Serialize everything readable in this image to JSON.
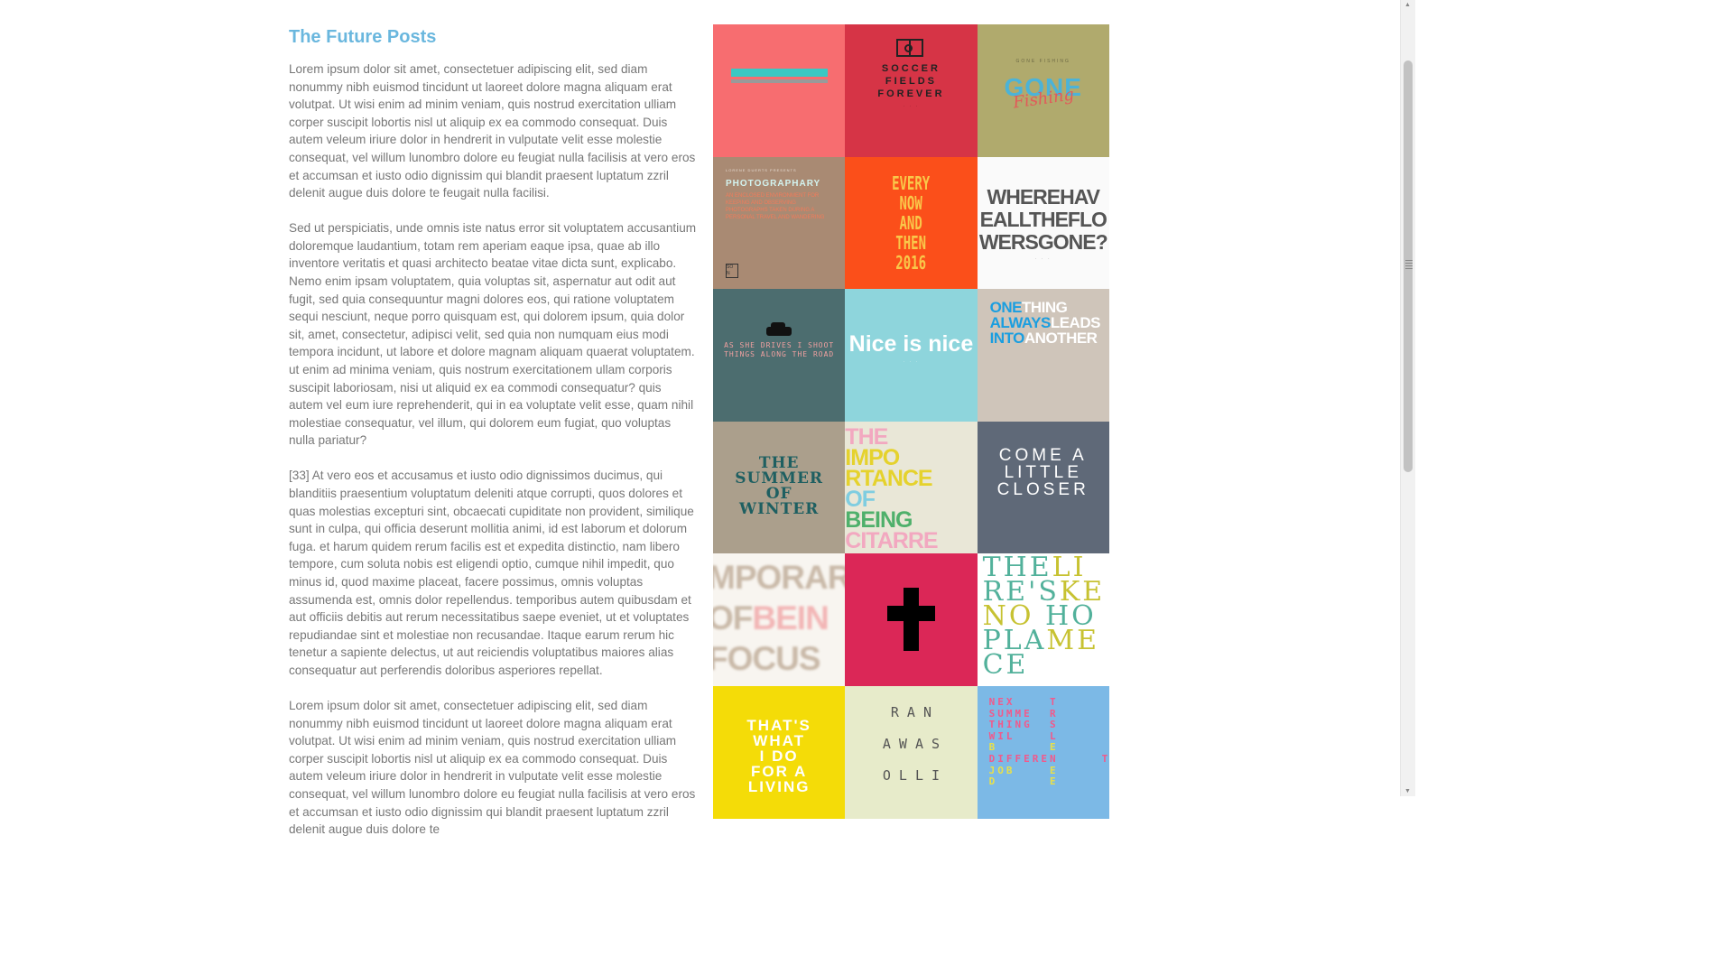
{
  "article": {
    "title": "The Future Posts",
    "paragraphs": [
      "Lorem ipsum dolor sit amet, consectetuer adipiscing elit, sed diam nonummy nibh euismod tincidunt ut laoreet dolore magna aliquam erat volutpat. Ut wisi enim ad minim veniam, quis nostrud exercitation ulliam corper suscipit lobortis nisl ut aliquip ex ea commodo consequat. Duis autem veleum iriure dolor in hendrerit in vulputate velit esse molestie consequat, vel willum lunombro dolore eu feugiat nulla facilisis at vero eros et accumsan et iusto odio dignissim qui blandit praesent luptatum zzril delenit augue duis dolore te feugait nulla facilisi.",
      "Sed ut perspiciatis, unde omnis iste natus error sit voluptatem accusantium doloremque laudantium, totam rem aperiam eaque ipsa, quae ab illo inventore veritatis et quasi architecto beatae vitae dicta sunt, explicabo. Nemo enim ipsam voluptatem, quia voluptas sit, aspernatur aut odit aut fugit, sed quia consequuntur magni dolores eos, qui ratione voluptatem sequi nesciunt, neque porro quisquam est, qui dolorem ipsum, quia dolor sit, amet, consectetur, adipisci velit, sed quia non numquam eius modi tempora incidunt, ut labore et dolore magnam aliquam quaerat voluptatem. ut enim ad minima veniam, quis nostrum exercitationem ullam corporis suscipit laboriosam, nisi ut aliquid ex ea commodi consequatur? quis autem vel eum iure reprehenderit, qui in ea voluptate velit esse, quam nihil molestiae consequatur, vel illum, qui dolorem eum fugiat, quo voluptas nulla pariatur?",
      "[33] At vero eos et accusamus et iusto odio dignissimos ducimus, qui blanditiis praesentium voluptatum deleniti atque corrupti, quos dolores et quas molestias excepturi sint, obcaecati cupiditate non provident, similique sunt in culpa, qui officia deserunt mollitia animi, id est laborum et dolorum fuga. et harum quidem rerum facilis est et expedita distinctio, nam libero tempore, cum soluta nobis est eligendi optio, cumque nihil impedit, quo minus id, quod maxime placeat, facere possimus, omnis voluptas assumenda est, omnis dolor repellendus. temporibus autem quibusdam et aut officiis debitis aut rerum necessitatibus saepe eveniet, ut et voluptates repudiandae sint et molestiae non recusandae. Itaque earum rerum hic tenetur a sapiente delectus, ut aut reiciendis voluptatibus maiores alias consequatur aut perferendis doloribus asperiores repellat.",
      "Lorem ipsum dolor sit amet, consectetuer adipiscing elit, sed diam nonummy nibh euismod tincidunt ut laoreet dolore magna aliquam erat volutpat. Ut wisi enim ad minim veniam, quis nostrud exercitation ulliam corper suscipit lobortis nisl ut aliquip ex ea commodo consequat. Duis autem veleum iriure dolor in hendrerit in vulputate velit esse molestie consequat, vel willum lunombro dolore eu feugiat nulla facilisis at vero eros et accumsan et iusto odio dignissim qui blandit praesent luptatum zzril delenit augue duis dolore te"
    ]
  },
  "gallery": {
    "tiles": [
      {
        "text": "",
        "bg": "#f76d70"
      },
      {
        "text": "SOCCER\nFIELDS\nFOREVER",
        "bg": "#d63446",
        "color": "#222222"
      },
      {
        "text": "GONE\nFishing",
        "bg": "#b0aa6d",
        "color": "#4bb3d8"
      },
      {
        "text": "PHOTOGRAPHARY",
        "bg": "#a98a73",
        "color": "#d3f4f0"
      },
      {
        "text": "EVERY\nNOW\nAND\nTHEN\n2016",
        "bg": "#fb4f1a",
        "color": "#f9c84a"
      },
      {
        "text": "WHEREHAV\nEALLTHEFLO\nWERSGONE?",
        "bg": "#fafafa",
        "color": "#555555"
      },
      {
        "text": "AS SHE DRIVES I SHOOT THINGS ALONG THE ROAD",
        "bg": "#4c6d6f",
        "color": "#f0a0a0"
      },
      {
        "text": "Nice is nice",
        "bg": "#8ed5dc",
        "color": "#ffffff"
      },
      {
        "text": "ONETHING\nALWAYSLEADS\nINTOANOTHER",
        "bg": "#cfc5ba",
        "color": "#1a9ee0"
      },
      {
        "text": "THE\nSUMMER\nOF\nWINTER",
        "bg": "#ab9f8c",
        "color": "#1e5f61"
      },
      {
        "text": "THE\nIMPO\nRTANCE\nOF\nBEING\nCITARRE",
        "bg": "#e9e7d7",
        "color": "#e5d22d"
      },
      {
        "text": "COME A\nLITTLE\nCLOSER",
        "bg": "#5f6978",
        "color": "#ffffff"
      },
      {
        "text": "MPORAR\nOFBEIN\nFOCUS",
        "bg": "#f8f5f0",
        "color": "#c9b9a8"
      },
      {
        "text": "",
        "bg": "#db2757",
        "color": "#000000"
      },
      {
        "text": "THE LI\nRE'S KE\nNO HO\nPLA ME\nCE",
        "bg": "#ffffff",
        "color": "#52b19b"
      },
      {
        "text": "THAT'S\nWHAT\nI DO\nFOR A\nLIVING",
        "bg": "#f4dc08",
        "color": "#ffffff"
      },
      {
        "text": "R A N\nA W A S\nO L L I",
        "bg": "#e7ebca",
        "color": "#555555"
      },
      {
        "text": "NEX T\nSUMME R\nTHING S\nWIL L\nB E\nDIFFEREN T\nJOB E\nD E",
        "bg": "#7cb9e6",
        "color": "#f2598b"
      }
    ]
  }
}
